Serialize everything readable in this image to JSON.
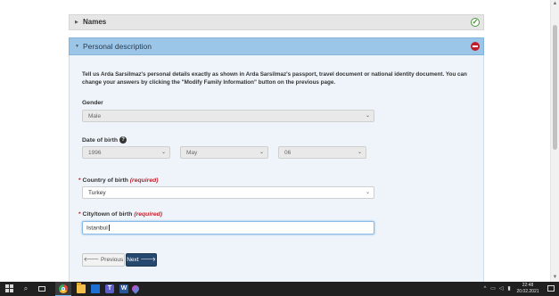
{
  "sections": {
    "names": {
      "title": "Names",
      "status_icon": "check-icon"
    },
    "personal": {
      "title": "Personal description",
      "status_icon": "minus-circle-icon"
    }
  },
  "intro_text": "Tell us Arda Sarsilmaz's personal details exactly as shown in Arda Sarsilmaz's passport, travel document or national identity document. You can change your answers by clicking the \"Modify Family Information\" button on the previous page.",
  "gender": {
    "label": "Gender",
    "value": "Male"
  },
  "dob": {
    "label": "Date of birth",
    "year": "1996",
    "month": "May",
    "day": "06"
  },
  "country": {
    "label": "Country of birth",
    "required_text": "(required)",
    "value": "Turkey"
  },
  "city": {
    "label": "City/town of birth",
    "required_text": "(required)",
    "value": "Istanbul"
  },
  "buttons": {
    "previous": "Previous",
    "next": "Next"
  },
  "taskbar": {
    "time": "22:48",
    "date": "20.02.2021"
  },
  "colors": {
    "header_active": "#9cc6e8",
    "next_button": "#26476e",
    "required": "#c21f2a"
  }
}
